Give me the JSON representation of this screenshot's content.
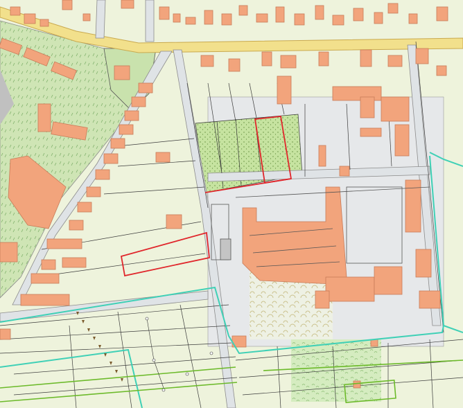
{
  "map": {
    "kind": "cadastral-map",
    "palette": {
      "background": "#eef3dc",
      "green_area": "#c9e2ad",
      "dotted_field": "#c6e3a0",
      "road": "#dfe3e6",
      "road_edge": "#8c8c8c",
      "main_road": "#f2e08c",
      "main_road_edge": "#c9a94e",
      "building": "#f2a47c",
      "building_edge": "#c77b58",
      "parcel_line": "#3a3a3a",
      "highlight_parcel": "#e0262b",
      "zone_boundary": "#3fd0b6",
      "green_boundary": "#6cba2a",
      "industrial_area": "#e6e8ea"
    }
  }
}
